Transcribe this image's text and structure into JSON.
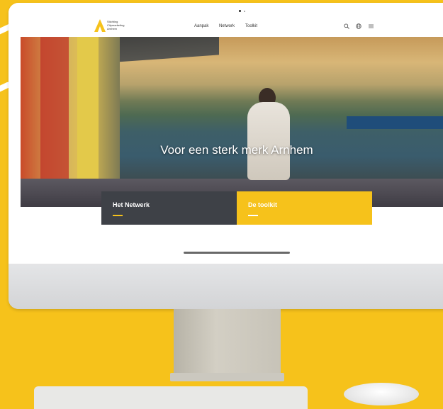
{
  "site": {
    "logo_lines": [
      "Stichting",
      "Citymarketing",
      "Arnhem"
    ]
  },
  "nav": {
    "items": [
      {
        "label": "Aanpak"
      },
      {
        "label": "Network"
      },
      {
        "label": "Toolkit"
      }
    ],
    "icons": [
      "search-icon",
      "language-icon",
      "menu-icon"
    ]
  },
  "hero": {
    "title": "Voor een sterk merk Arnhem"
  },
  "cards": [
    {
      "label": "Het Netwerk",
      "color": "#3e4147"
    },
    {
      "label": "De toolkit",
      "color": "#f6c21b"
    }
  ],
  "colors": {
    "background": "#f6c21b",
    "brand_yellow": "#f6c21b",
    "dark": "#3e4147"
  }
}
